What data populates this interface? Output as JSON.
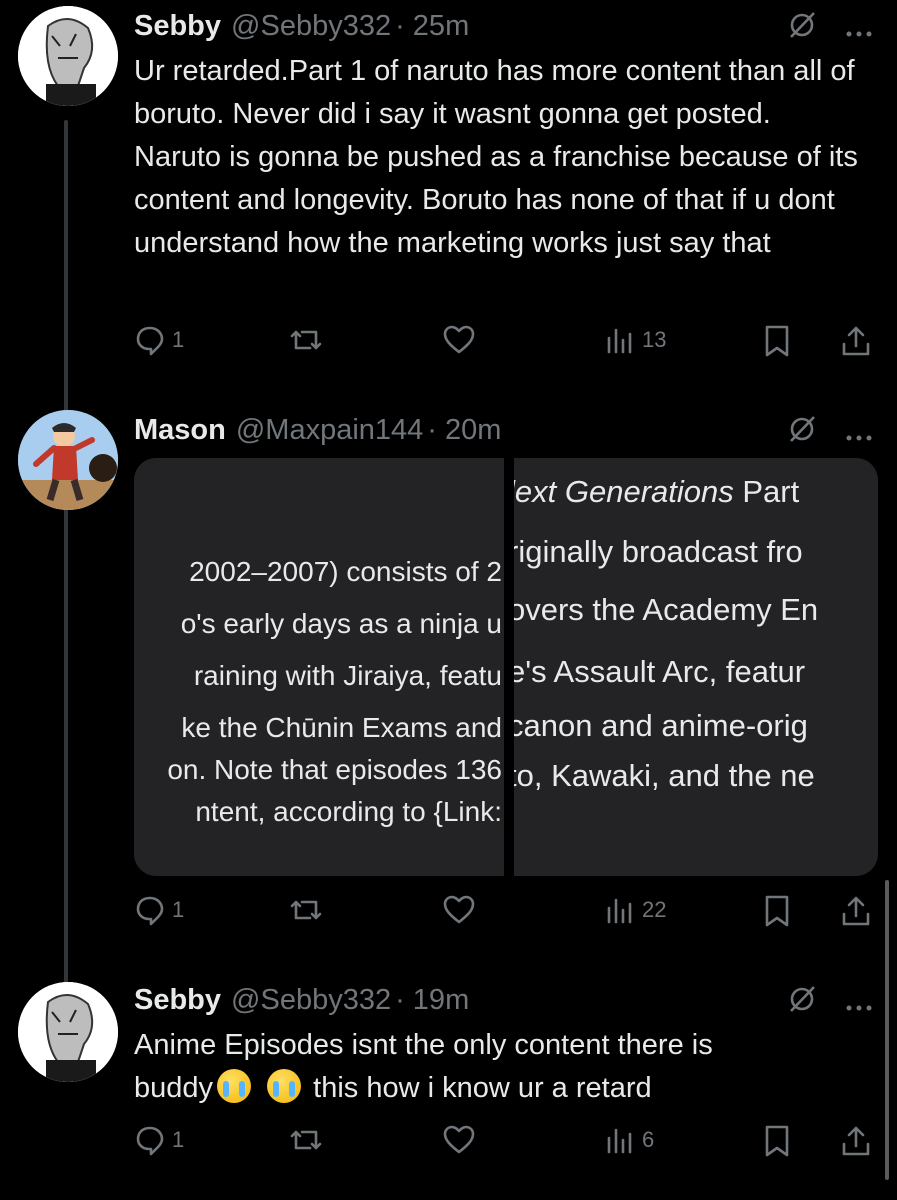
{
  "tweets": [
    {
      "name": "Sebby",
      "handle": "@Sebby332",
      "time": "· 25m",
      "text": "Ur retarded.Part 1 of naruto has more content than all of boruto. Never did i say it wasnt gonna get posted. Naruto is gonna be pushed as a franchise because of its content and longevity. Boruto has none of that if u dont understand how the marketing works just say that",
      "replies": "1",
      "views": "13"
    },
    {
      "name": "Mason",
      "handle": "@Maxpain144",
      "time": "· 20m",
      "replies": "1",
      "views": "22",
      "media": {
        "left_lines": [
          "2002–2007) consists of 2",
          "o's early days as a ninja u",
          "raining with Jiraiya, featu",
          "ke the Chūnin Exams and",
          "on. Note that episodes 136",
          "ntent, according to {Link:"
        ],
        "right_line_0_italic": "lext Generations",
        "right_line_0_rest": " Part",
        "right_lines": [
          "riginally broadcast fro",
          "overs the Academy En",
          "e's Assault Arc, featur",
          "canon and anime-orig",
          "to, Kawaki, and the ne"
        ]
      }
    },
    {
      "name": "Sebby",
      "handle": "@Sebby332",
      "time": "· 19m",
      "text_part1": "Anime Episodes isnt the only content there is",
      "text_part2_a": "buddy",
      "text_part2_b": "this how i know ur a retard",
      "emoji": [
        "loudly-crying-face",
        "loudly-crying-face"
      ],
      "replies": "1",
      "views": "6"
    }
  ],
  "colors": {
    "background": "#000000",
    "text": "#e7e9ea",
    "muted": "#71767b",
    "thread_line": "#333639"
  }
}
